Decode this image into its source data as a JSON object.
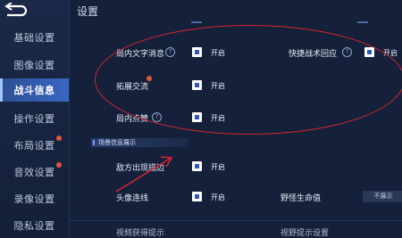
{
  "page_title": "设置",
  "sidebar": {
    "items": [
      {
        "label": "基础设置"
      },
      {
        "label": "图像设置"
      },
      {
        "label": "战斗信息"
      },
      {
        "label": "操作设置"
      },
      {
        "label": "布局设置"
      },
      {
        "label": "音效设置"
      },
      {
        "label": "录像设置"
      },
      {
        "label": "隐私设置"
      }
    ]
  },
  "settings": {
    "in_game_text_msg": {
      "label": "局内文字消息",
      "value": "开启"
    },
    "quick_battle_reply": {
      "label": "快捷战术回应",
      "value": "开启"
    },
    "expand_chat": {
      "label": "拓展交流",
      "value": "开启"
    },
    "in_game_like": {
      "label": "局内点赞",
      "value": "开启"
    },
    "enemy_outline": {
      "label": "敌方出现描边",
      "value": "开启"
    },
    "avatar_line": {
      "label": "头像连线",
      "value": "开启"
    },
    "monster_hp": {
      "label": "野怪生命值",
      "value": "不展示"
    },
    "partial_bottom_left": {
      "label": "视频获得提示",
      "value": ""
    },
    "partial_bottom_right": {
      "label": "视野提示设置",
      "value": ""
    }
  },
  "section_header": "场景信息展示",
  "colors": {
    "accent": "#3a67c2",
    "badge": "#e2553f",
    "annotation": "#d6262e"
  }
}
